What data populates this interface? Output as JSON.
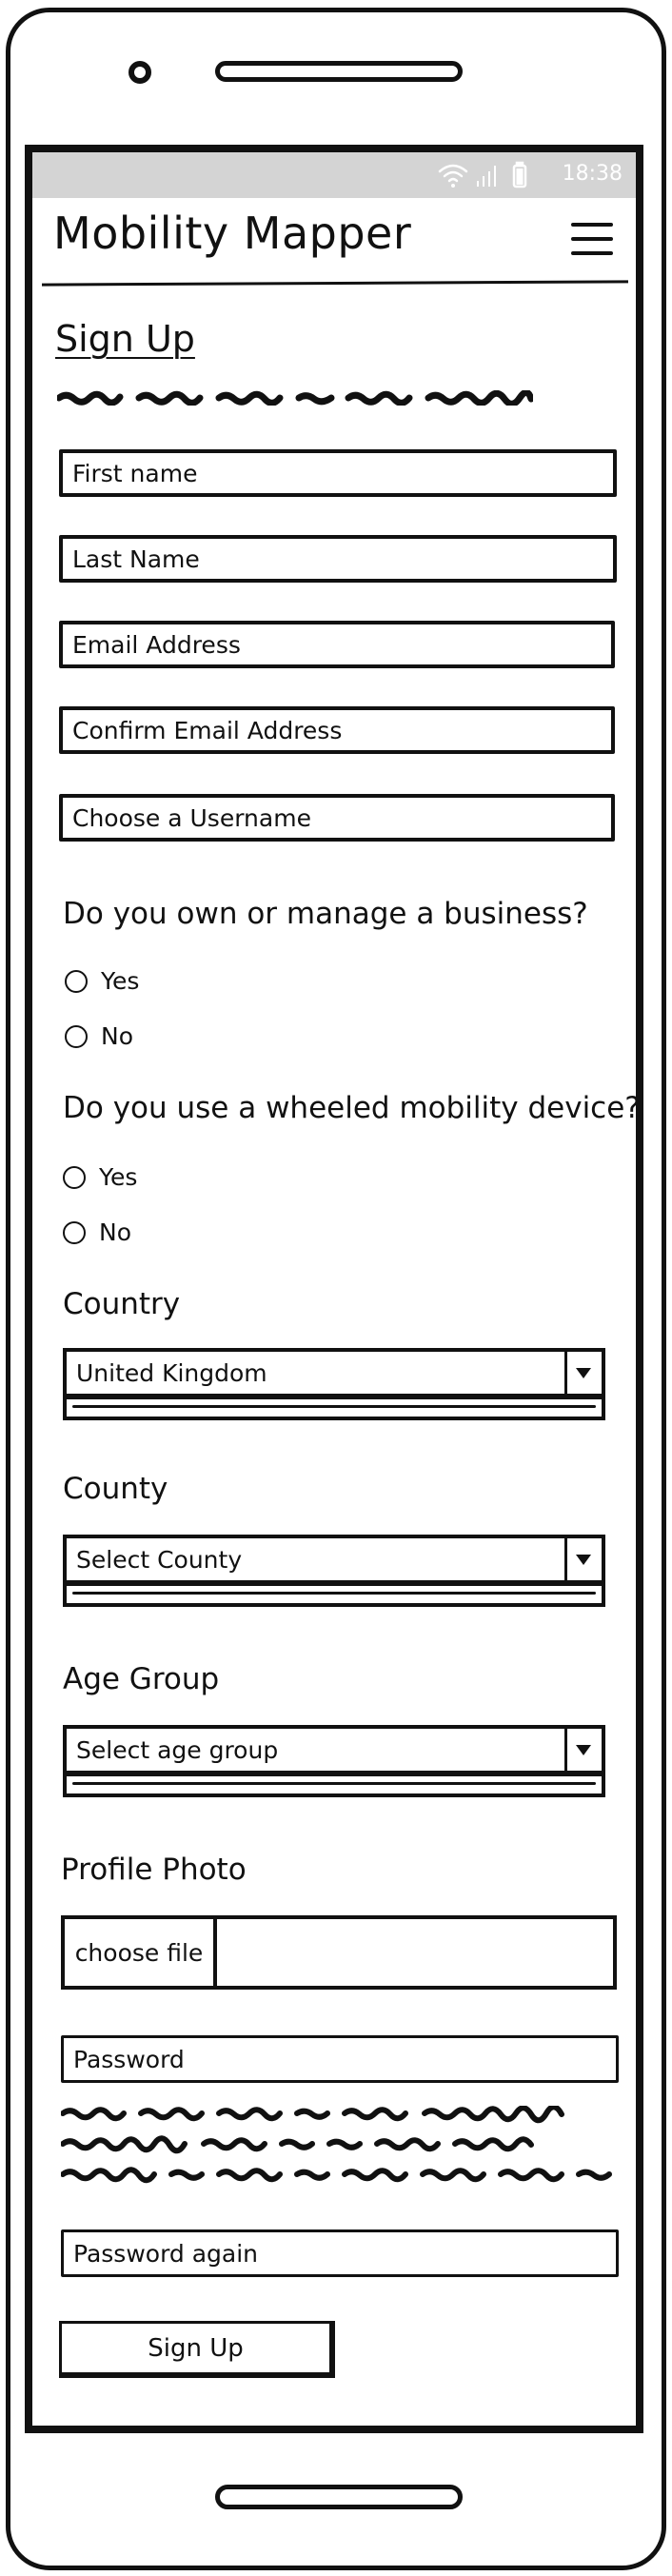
{
  "status_bar": {
    "time": "18:38"
  },
  "header": {
    "app_title": "Mobility Mapper",
    "menu_icon": "hamburger-menu-icon"
  },
  "form": {
    "title": "Sign Up",
    "first_name_placeholder": "First name",
    "last_name_placeholder": "Last Name",
    "email_placeholder": "Email Address",
    "confirm_email_placeholder": "Confirm Email Address",
    "username_placeholder": "Choose a Username",
    "business_question": "Do you own or manage a business?",
    "business_options": [
      "Yes",
      "No"
    ],
    "mobility_question": "Do you use a wheeled mobility device?",
    "mobility_options": [
      "Yes",
      "No"
    ],
    "country_label": "Country",
    "country_value": "United Kingdom",
    "county_label": "County",
    "county_value": "Select County",
    "age_label": "Age Group",
    "age_value": "Select age group",
    "photo_label": "Profile Photo",
    "choose_file_label": "choose file",
    "password_placeholder": "Password",
    "password_again_placeholder": "Password again",
    "submit_label": "Sign Up"
  },
  "icons": {
    "wifi": "wifi-icon",
    "signal": "signal-icon",
    "battery": "battery-icon"
  },
  "colors": {
    "status_bar_bg": "#d4d4d4",
    "ink": "#111111"
  }
}
